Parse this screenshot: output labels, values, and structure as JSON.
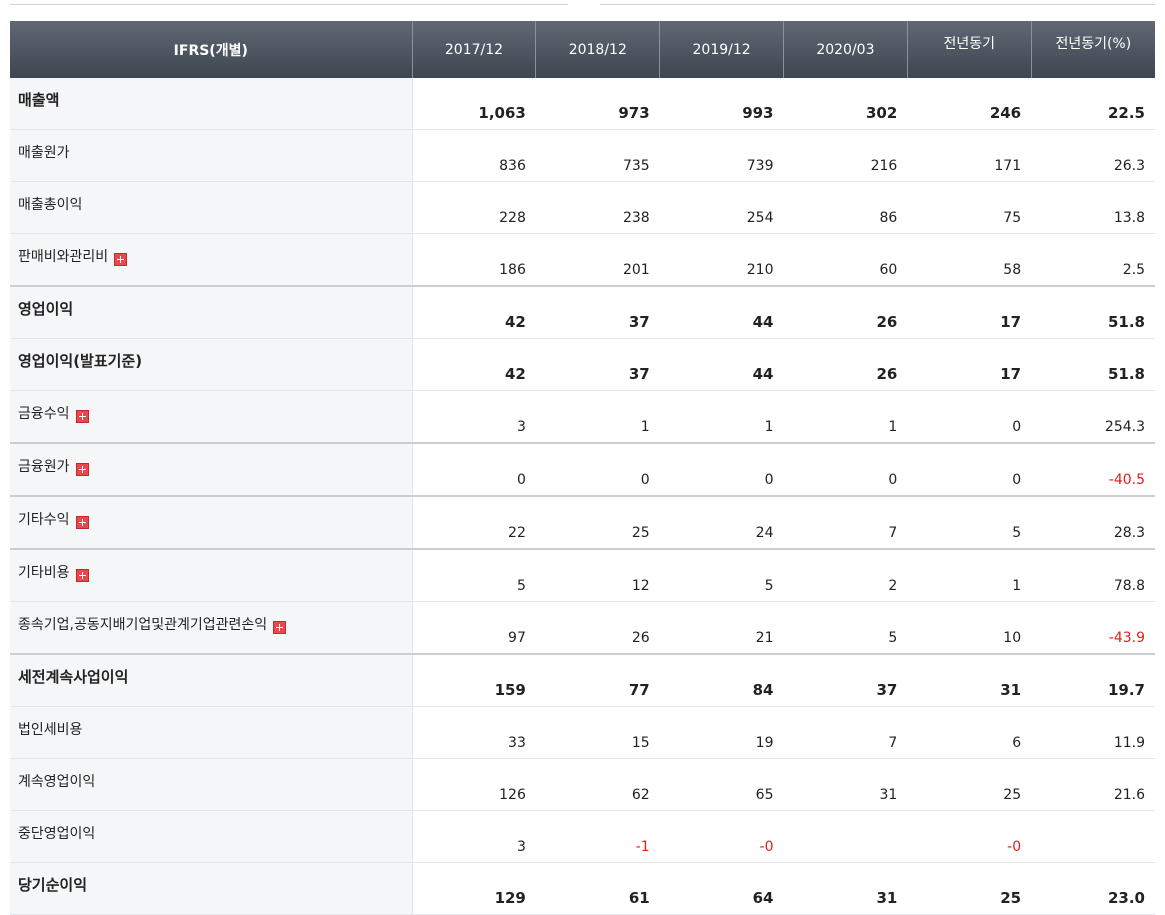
{
  "table": {
    "headers": [
      "IFRS(개별)",
      "2017/12",
      "2018/12",
      "2019/12",
      "2020/03",
      "전년동기",
      "전년동기(%)"
    ],
    "rows": [
      {
        "label": "매출액",
        "bold": true,
        "expand": false,
        "values": [
          "1,063",
          "973",
          "993",
          "302",
          "246",
          "22.5"
        ]
      },
      {
        "label": "매출원가",
        "bold": false,
        "expand": false,
        "values": [
          "836",
          "735",
          "739",
          "216",
          "171",
          "26.3"
        ]
      },
      {
        "label": "매출총이익",
        "bold": false,
        "expand": false,
        "values": [
          "228",
          "238",
          "254",
          "86",
          "75",
          "13.8"
        ]
      },
      {
        "label": "판매비와관리비",
        "bold": false,
        "expand": true,
        "values": [
          "186",
          "201",
          "210",
          "60",
          "58",
          "2.5"
        ]
      },
      {
        "label": "영업이익",
        "bold": true,
        "expand": false,
        "values": [
          "42",
          "37",
          "44",
          "26",
          "17",
          "51.8"
        ]
      },
      {
        "label": "영업이익(발표기준)",
        "bold": true,
        "expand": false,
        "values": [
          "42",
          "37",
          "44",
          "26",
          "17",
          "51.8"
        ]
      },
      {
        "label": "금융수익",
        "bold": false,
        "expand": true,
        "values": [
          "3",
          "1",
          "1",
          "1",
          "0",
          "254.3"
        ]
      },
      {
        "label": "금융원가",
        "bold": false,
        "expand": true,
        "values": [
          "0",
          "0",
          "0",
          "0",
          "0",
          "-40.5"
        ]
      },
      {
        "label": "기타수익",
        "bold": false,
        "expand": true,
        "values": [
          "22",
          "25",
          "24",
          "7",
          "5",
          "28.3"
        ]
      },
      {
        "label": "기타비용",
        "bold": false,
        "expand": true,
        "values": [
          "5",
          "12",
          "5",
          "2",
          "1",
          "78.8"
        ]
      },
      {
        "label": "종속기업,공동지배기업및관계기업관련손익",
        "bold": false,
        "expand": true,
        "values": [
          "97",
          "26",
          "21",
          "5",
          "10",
          "-43.9"
        ]
      },
      {
        "label": "세전계속사업이익",
        "bold": true,
        "expand": false,
        "values": [
          "159",
          "77",
          "84",
          "37",
          "31",
          "19.7"
        ]
      },
      {
        "label": "법인세비용",
        "bold": false,
        "expand": false,
        "values": [
          "33",
          "15",
          "19",
          "7",
          "6",
          "11.9"
        ]
      },
      {
        "label": "계속영업이익",
        "bold": false,
        "expand": false,
        "values": [
          "126",
          "62",
          "65",
          "31",
          "25",
          "21.6"
        ]
      },
      {
        "label": "중단영업이익",
        "bold": false,
        "expand": false,
        "values": [
          "3",
          "-1",
          "-0",
          "",
          "-0",
          ""
        ]
      },
      {
        "label": "당기순이익",
        "bold": true,
        "expand": false,
        "values": [
          "129",
          "61",
          "64",
          "31",
          "25",
          "23.0"
        ]
      }
    ]
  },
  "colors": {
    "header_bg": "#4a525c",
    "negative": "#e0201b",
    "expand_icon": "#e8494d"
  },
  "icons": {
    "expand": "plus-square-icon"
  }
}
